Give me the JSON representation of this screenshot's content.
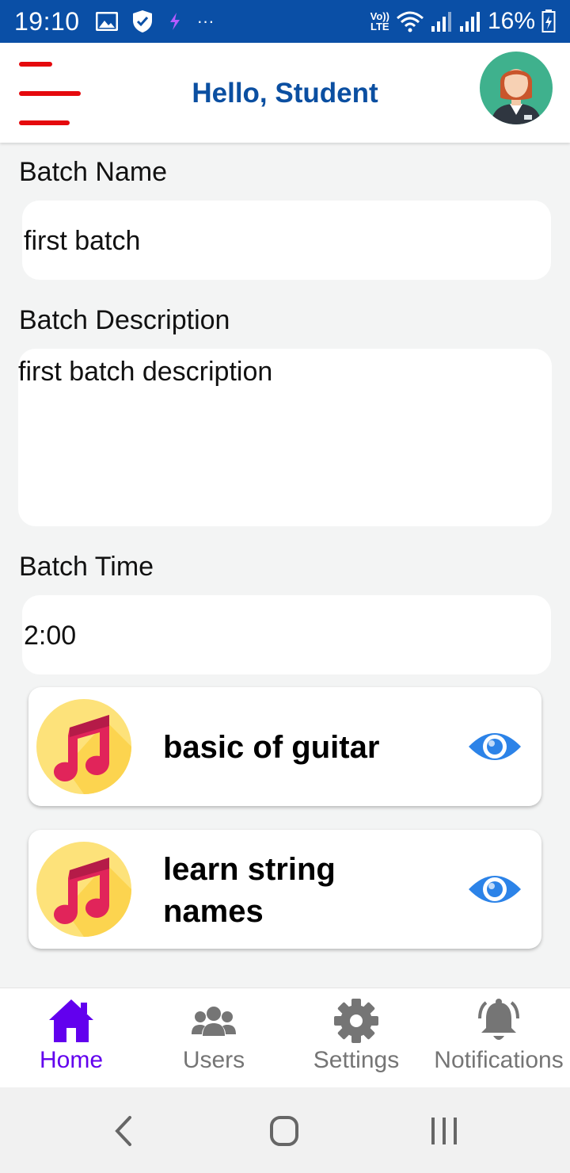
{
  "status_bar": {
    "time": "19:10",
    "battery": "16%",
    "network_label": "Vo))\nLTE",
    "overflow": "···"
  },
  "header": {
    "title": "Hello, Student",
    "menu_color": "#e5090d",
    "title_color": "#0b4fa1"
  },
  "form": {
    "batch_name_label": "Batch Name",
    "batch_name_value": "first batch",
    "batch_description_label": "Batch Description",
    "batch_description_value": "first batch description",
    "batch_time_label": "Batch Time",
    "batch_time_value": "2:00"
  },
  "lessons": [
    {
      "title": "basic of guitar",
      "icon": "music-note-icon",
      "action_icon": "eye-icon"
    },
    {
      "title": "learn string names",
      "icon": "music-note-icon",
      "action_icon": "eye-icon"
    }
  ],
  "bottom_nav": {
    "items": [
      {
        "label": "Home",
        "icon": "home-icon",
        "active": true
      },
      {
        "label": "Users",
        "icon": "users-icon",
        "active": false
      },
      {
        "label": "Settings",
        "icon": "gear-icon",
        "active": false
      },
      {
        "label": "Notifications",
        "icon": "bell-icon",
        "active": false
      }
    ],
    "active_color": "#6200ee",
    "inactive_color": "#757575"
  },
  "system_nav": {
    "buttons": [
      "back",
      "home",
      "recents"
    ]
  }
}
